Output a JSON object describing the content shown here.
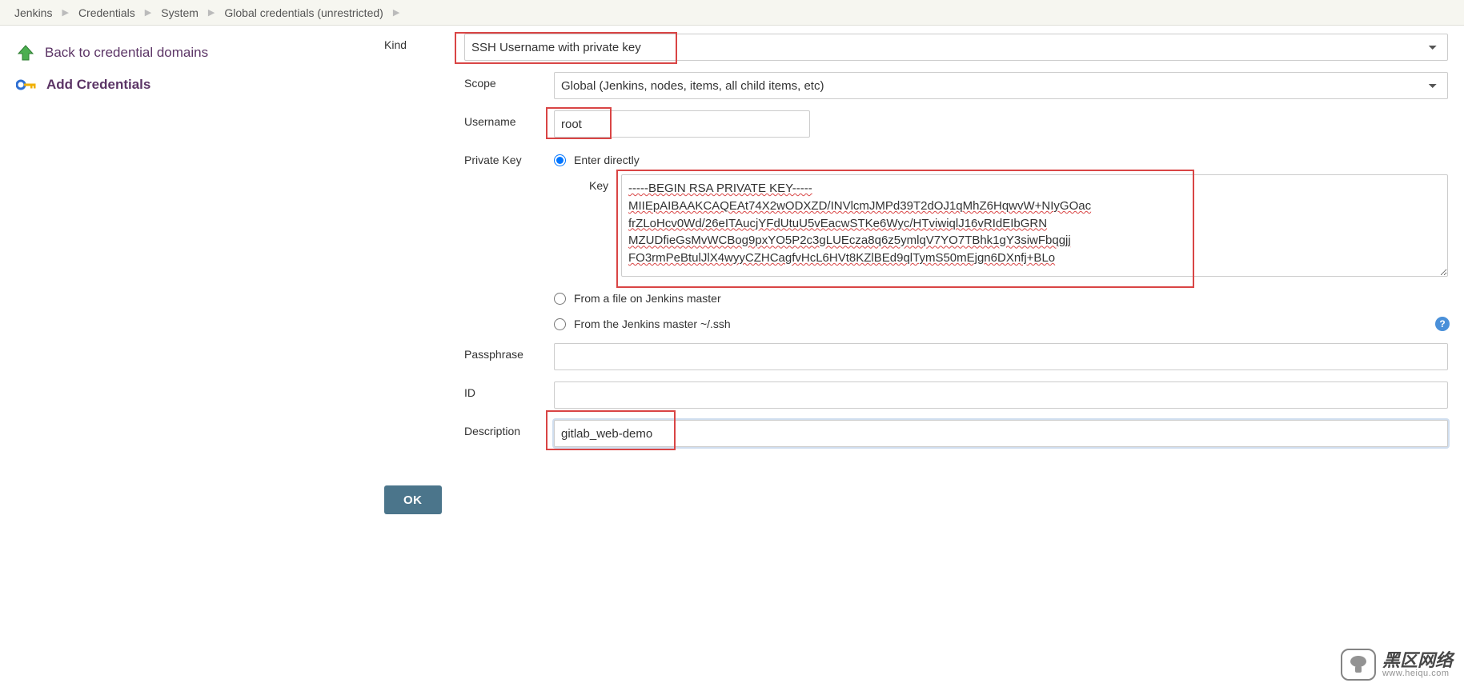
{
  "breadcrumbs": [
    "Jenkins",
    "Credentials",
    "System",
    "Global credentials (unrestricted)"
  ],
  "sidebar": {
    "back_label": "Back to credential domains",
    "add_label": "Add Credentials"
  },
  "form": {
    "kind_label": "Kind",
    "kind_value": "SSH Username with private key",
    "scope_label": "Scope",
    "scope_value": "Global (Jenkins, nodes, items, all child items, etc)",
    "username_label": "Username",
    "username_value": "root",
    "privatekey_label": "Private Key",
    "pk_enter_directly": "Enter directly",
    "pk_key_label": "Key",
    "pk_key_value": "-----BEGIN RSA PRIVATE KEY-----\nMIIEpAIBAAKCAQEAt74X2wODXZD/INVlcmJMPd39T2dOJ1qMhZ6HqwvW+NIyGOac\nfrZLoHcv0Wd/26eITAucjYFdUtuU5vEacwSTKe6Wyc/HTviwiqlJ16vRIdEIbGRN\nMZUDfieGsMvWCBog9pxYO5P2c3gLUEcza8q6z5ymlqV7YO7TBhk1gY3siwFbqgjj\nFO3rmPeBtulJlX4wyyCZHCagfvHcL6HVt8KZlBEd9qlTymS50mEjgn6DXnfj+BLo",
    "pk_from_file": "From a file on Jenkins master",
    "pk_from_ssh": "From the Jenkins master ~/.ssh",
    "passphrase_label": "Passphrase",
    "passphrase_value": "",
    "id_label": "ID",
    "id_value": "",
    "description_label": "Description",
    "description_value": "gitlab_web-demo",
    "ok_label": "OK"
  },
  "watermark": {
    "cn": "黑区网络",
    "en": "www.heiqu.com"
  }
}
